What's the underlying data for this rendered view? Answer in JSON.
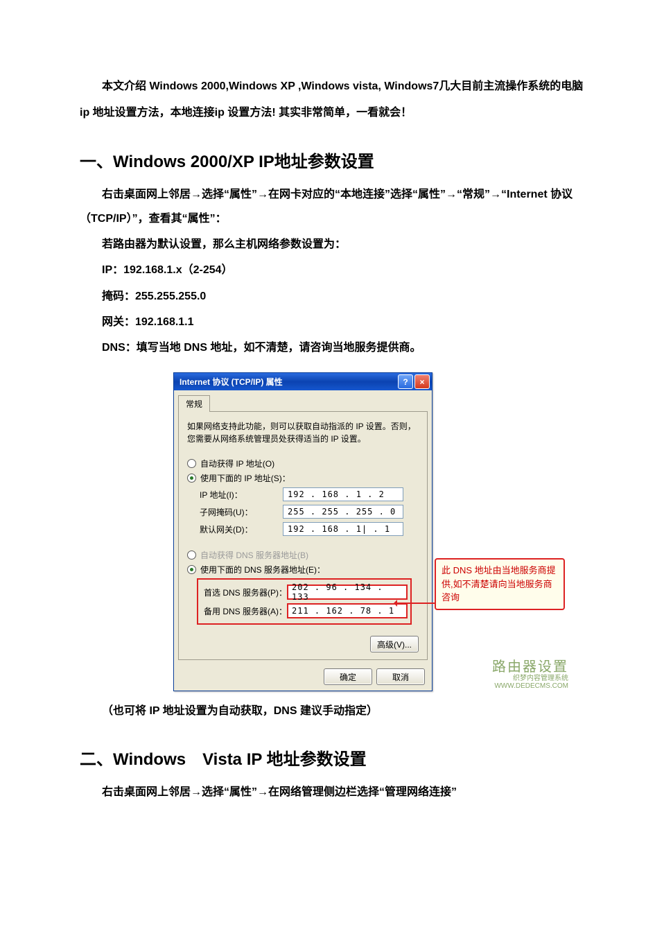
{
  "intro": "本文介绍 Windows 2000,Windows XP ,Windows vista, Windows7几大目前主流操作系统的电脑 ip 地址设置方法，本地连接ip 设置方法! 其实非常简单，一看就会！",
  "section1": {
    "title": "一、Windows 2000/XP IP地址参数设置",
    "p1": "右击桌面网上邻居→选择“属性”→在网卡对应的“本地连接”选择“属性”→“常规”→“Internet 协议（TCP/IP）”，查看其“属性”：",
    "p2": "若路由器为默认设置，那么主机网络参数设置为：",
    "p3": "IP：192.168.1.x（2-254）",
    "p4": "掩码：255.255.255.0",
    "p5": "网关：192.168.1.1",
    "p6": "DNS：填写当地 DNS 地址，如不清楚，请咨询当地服务提供商。",
    "caption": "（也可将 IP 地址设置为自动获取，DNS 建议手动指定）"
  },
  "dialog": {
    "title": "Internet 协议 (TCP/IP) 属性",
    "helpBtn": "?",
    "closeBtn": "×",
    "tab": "常规",
    "desc": "如果网络支持此功能，则可以获取自动指派的 IP 设置。否则，您需要从网络系统管理员处获得适当的 IP 设置。",
    "radioAutoIp": "自动获得 IP 地址(O)",
    "radioUseIp": "使用下面的 IP 地址(S)：",
    "ipLabel": "IP 地址(I)：",
    "ipValue": "192 . 168 .  1  .  2",
    "maskLabel": "子网掩码(U)：",
    "maskValue": "255 . 255 . 255 .  0",
    "gwLabel": "默认网关(D)：",
    "gwValue": "192 . 168 .  1| .  1",
    "radioAutoDns": "自动获得 DNS 服务器地址(B)",
    "radioUseDns": "使用下面的 DNS 服务器地址(E)：",
    "dns1Label": "首选 DNS 服务器(P)：",
    "dns1Value": "202 .  96 . 134 . 133",
    "dns2Label": "备用 DNS 服务器(A)：",
    "dns2Value": "211 . 162 .  78 .  1",
    "advancedBtn": "高级(V)...",
    "okBtn": "确定",
    "cancelBtn": "取消"
  },
  "callout": "此 DNS 地址由当地服务商提供,如不清楚请向当地服务商咨询",
  "watermark": {
    "main": "路由器设置",
    "sub1": "织梦内容管理系统",
    "sub2": "WWW.DEDECMS.COM"
  },
  "section2": {
    "title": "二、Windows　Vista IP 地址参数设置",
    "p1": "右击桌面网上邻居→选择“属性”→在网络管理侧边栏选择“管理网络连接”"
  }
}
